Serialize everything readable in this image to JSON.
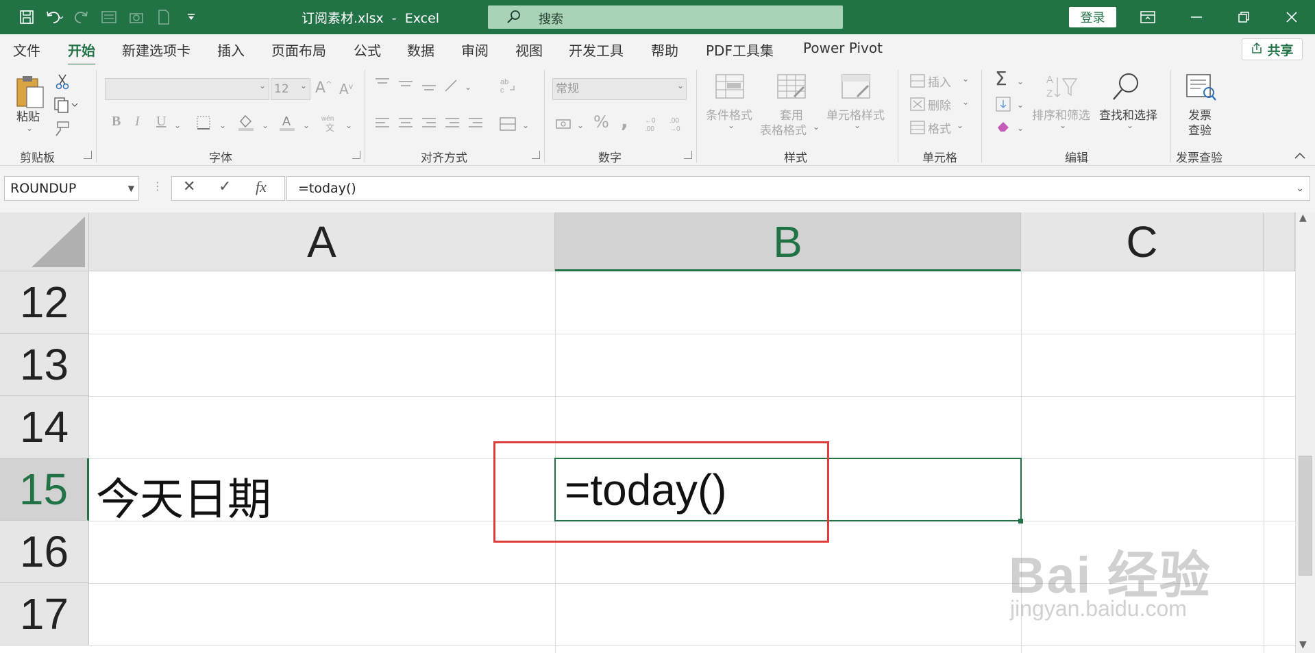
{
  "title_bar": {
    "document_title": "订阅素材.xlsx  -  Excel",
    "search_placeholder": "搜索",
    "login_label": "登录",
    "qat_icons": [
      "save-icon",
      "undo-icon",
      "redo-icon",
      "form-icon",
      "camera-icon",
      "print-preview-icon",
      "customize-qat-icon"
    ],
    "window_buttons": [
      "ribbon-display-icon",
      "minimize-icon",
      "restore-icon",
      "close-icon"
    ]
  },
  "ribbon_tabs": {
    "items": [
      "文件",
      "开始",
      "新建选项卡",
      "插入",
      "页面布局",
      "公式",
      "数据",
      "审阅",
      "视图",
      "开发工具",
      "帮助",
      "PDF工具集",
      "Power Pivot"
    ],
    "active": "开始",
    "share_label": "共享"
  },
  "ribbon": {
    "clipboard": {
      "paste_label": "粘贴",
      "group_label": "剪贴板"
    },
    "font": {
      "font_name": "",
      "font_size": "12",
      "group_label": "字体"
    },
    "alignment": {
      "group_label": "对齐方式"
    },
    "number": {
      "format": "常规",
      "group_label": "数字"
    },
    "styles": {
      "conditional_label": "条件格式",
      "table_label_1": "套用",
      "table_label_2": "表格格式",
      "cell_styles_label": "单元格样式",
      "group_label": "样式"
    },
    "cells": {
      "insert_label": "插入",
      "delete_label": "删除",
      "format_label": "格式",
      "group_label": "单元格"
    },
    "editing": {
      "sort_label": "排序和筛选",
      "find_label": "查找和选择",
      "group_label": "编辑"
    },
    "invoice": {
      "button_label_1": "发票",
      "button_label_2": "查验",
      "group_label": "发票查验"
    }
  },
  "formula_bar": {
    "name_box": "ROUNDUP",
    "cancel_icon": "✕",
    "enter_icon": "✓",
    "fx_label": "fx",
    "formula": "=today()"
  },
  "grid": {
    "columns": [
      "A",
      "B",
      "C"
    ],
    "selected_column": "B",
    "rows": [
      "12",
      "13",
      "14",
      "15",
      "16",
      "17"
    ],
    "selected_row": "15",
    "cells": {
      "A15": "今天日期",
      "B15": "=today()"
    }
  },
  "watermark": {
    "brand": "Bai  经验",
    "url": "jingyan.baidu.com"
  },
  "accent_colors": {
    "excel_green": "#217346",
    "highlight_red": "#e03c3c"
  }
}
